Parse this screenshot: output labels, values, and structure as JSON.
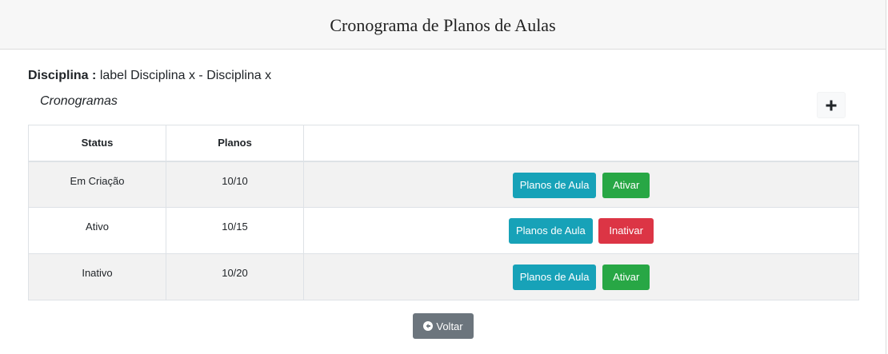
{
  "header": {
    "title": "Cronograma de Planos de Aulas"
  },
  "disciplina": {
    "label": "Disciplina :",
    "value": "label Disciplina x - Disciplina x"
  },
  "section": {
    "title": "Cronogramas"
  },
  "table": {
    "headers": [
      "Status",
      "Planos",
      ""
    ],
    "rows": [
      {
        "status": "Em Criação",
        "planos": "10/10",
        "btn_planos": "Planos de Aula",
        "btn_action": "Ativar"
      },
      {
        "status": "Ativo",
        "planos": "10/15",
        "btn_planos": "Planos de Aula",
        "btn_action": "Inativar"
      },
      {
        "status": "Inativo",
        "planos": "10/20",
        "btn_planos": "Planos de Aula",
        "btn_action": "Ativar"
      }
    ]
  },
  "buttons": {
    "back_label": "Voltar"
  },
  "icons": {
    "add": "plus-icon",
    "back": "arrow-circle-left-icon"
  },
  "colors": {
    "info": "#17a2b8",
    "success": "#28a745",
    "danger": "#dc3545",
    "secondary": "#6c757d"
  }
}
